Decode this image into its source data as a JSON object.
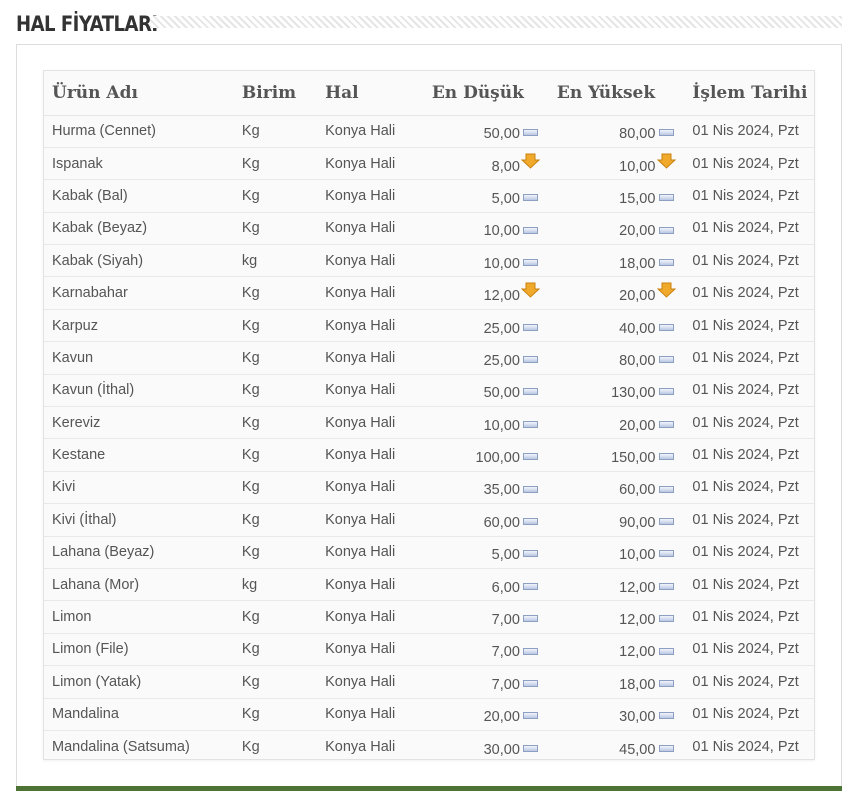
{
  "header": {
    "title": "HAL FİYATLARI"
  },
  "table": {
    "columns": [
      "Ürün Adı",
      "Birim",
      "Hal",
      "En Düşük",
      "En Yüksek",
      "İşlem Tarihi"
    ],
    "rows": [
      {
        "name": "Hurma (Cennet)",
        "unit": "Kg",
        "hal": "Konya Hali",
        "min": "50,00",
        "min_trend": "flat",
        "max": "80,00",
        "max_trend": "flat",
        "date": "01 Nis 2024, Pzt"
      },
      {
        "name": "Ispanak",
        "unit": "Kg",
        "hal": "Konya Hali",
        "min": "8,00",
        "min_trend": "down",
        "max": "10,00",
        "max_trend": "down",
        "date": "01 Nis 2024, Pzt"
      },
      {
        "name": "Kabak (Bal)",
        "unit": "Kg",
        "hal": "Konya Hali",
        "min": "5,00",
        "min_trend": "flat",
        "max": "15,00",
        "max_trend": "flat",
        "date": "01 Nis 2024, Pzt"
      },
      {
        "name": "Kabak (Beyaz)",
        "unit": "Kg",
        "hal": "Konya Hali",
        "min": "10,00",
        "min_trend": "flat",
        "max": "20,00",
        "max_trend": "flat",
        "date": "01 Nis 2024, Pzt"
      },
      {
        "name": "Kabak (Siyah)",
        "unit": "kg",
        "hal": "Konya Hali",
        "min": "10,00",
        "min_trend": "flat",
        "max": "18,00",
        "max_trend": "flat",
        "date": "01 Nis 2024, Pzt"
      },
      {
        "name": "Karnabahar",
        "unit": "Kg",
        "hal": "Konya Hali",
        "min": "12,00",
        "min_trend": "down",
        "max": "20,00",
        "max_trend": "down",
        "date": "01 Nis 2024, Pzt"
      },
      {
        "name": "Karpuz",
        "unit": "Kg",
        "hal": "Konya Hali",
        "min": "25,00",
        "min_trend": "flat",
        "max": "40,00",
        "max_trend": "flat",
        "date": "01 Nis 2024, Pzt"
      },
      {
        "name": "Kavun",
        "unit": "Kg",
        "hal": "Konya Hali",
        "min": "25,00",
        "min_trend": "flat",
        "max": "80,00",
        "max_trend": "flat",
        "date": "01 Nis 2024, Pzt"
      },
      {
        "name": "Kavun (İthal)",
        "unit": "Kg",
        "hal": "Konya Hali",
        "min": "50,00",
        "min_trend": "flat",
        "max": "130,00",
        "max_trend": "flat",
        "date": "01 Nis 2024, Pzt"
      },
      {
        "name": "Kereviz",
        "unit": "Kg",
        "hal": "Konya Hali",
        "min": "10,00",
        "min_trend": "flat",
        "max": "20,00",
        "max_trend": "flat",
        "date": "01 Nis 2024, Pzt"
      },
      {
        "name": "Kestane",
        "unit": "Kg",
        "hal": "Konya Hali",
        "min": "100,00",
        "min_trend": "flat",
        "max": "150,00",
        "max_trend": "flat",
        "date": "01 Nis 2024, Pzt"
      },
      {
        "name": "Kivi",
        "unit": "Kg",
        "hal": "Konya Hali",
        "min": "35,00",
        "min_trend": "flat",
        "max": "60,00",
        "max_trend": "flat",
        "date": "01 Nis 2024, Pzt"
      },
      {
        "name": "Kivi (İthal)",
        "unit": "Kg",
        "hal": "Konya Hali",
        "min": "60,00",
        "min_trend": "flat",
        "max": "90,00",
        "max_trend": "flat",
        "date": "01 Nis 2024, Pzt"
      },
      {
        "name": "Lahana (Beyaz)",
        "unit": "Kg",
        "hal": "Konya Hali",
        "min": "5,00",
        "min_trend": "flat",
        "max": "10,00",
        "max_trend": "flat",
        "date": "01 Nis 2024, Pzt"
      },
      {
        "name": "Lahana (Mor)",
        "unit": "kg",
        "hal": "Konya Hali",
        "min": "6,00",
        "min_trend": "flat",
        "max": "12,00",
        "max_trend": "flat",
        "date": "01 Nis 2024, Pzt"
      },
      {
        "name": "Limon",
        "unit": "Kg",
        "hal": "Konya Hali",
        "min": "7,00",
        "min_trend": "flat",
        "max": "12,00",
        "max_trend": "flat",
        "date": "01 Nis 2024, Pzt"
      },
      {
        "name": "Limon (File)",
        "unit": "Kg",
        "hal": "Konya Hali",
        "min": "7,00",
        "min_trend": "flat",
        "max": "12,00",
        "max_trend": "flat",
        "date": "01 Nis 2024, Pzt"
      },
      {
        "name": "Limon (Yatak)",
        "unit": "Kg",
        "hal": "Konya Hali",
        "min": "7,00",
        "min_trend": "flat",
        "max": "18,00",
        "max_trend": "flat",
        "date": "01 Nis 2024, Pzt"
      },
      {
        "name": "Mandalina",
        "unit": "Kg",
        "hal": "Konya Hali",
        "min": "20,00",
        "min_trend": "flat",
        "max": "30,00",
        "max_trend": "flat",
        "date": "01 Nis 2024, Pzt"
      },
      {
        "name": "Mandalina (Satsuma)",
        "unit": "Kg",
        "hal": "Konya Hali",
        "min": "30,00",
        "min_trend": "flat",
        "max": "45,00",
        "max_trend": "flat",
        "date": "01 Nis 2024, Pzt"
      }
    ]
  },
  "icons": {
    "flat": "no-change-icon",
    "down": "price-down-arrow-icon"
  },
  "colors": {
    "accent_footer": "#4d7335",
    "arrow_down": "#f0a92b"
  }
}
